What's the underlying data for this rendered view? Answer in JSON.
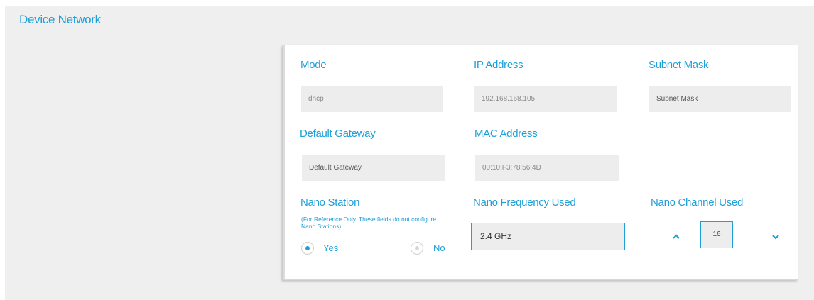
{
  "section": {
    "title": "Device Network"
  },
  "mode": {
    "label": "Mode",
    "value": "dhcp"
  },
  "ip_address": {
    "label": "IP Address",
    "value": "192.168.168.105"
  },
  "subnet_mask": {
    "label": "Subnet Mask",
    "placeholder": "Subnet Mask"
  },
  "default_gateway": {
    "label": "Default Gateway",
    "placeholder": "Default Gateway"
  },
  "mac_address": {
    "label": "MAC Address",
    "value": "00:10:F3:78:56:4D"
  },
  "nano_station": {
    "label": "Nano Station",
    "note": "(For Reference Only. These fields do not configure Nano Stations)",
    "options": [
      {
        "label": "Yes",
        "selected": true
      },
      {
        "label": "No",
        "selected": false
      }
    ]
  },
  "nano_frequency": {
    "label": "Nano Frequency Used",
    "value": "2.4 GHz"
  },
  "nano_channel": {
    "label": "Nano Channel Used",
    "value": "16"
  },
  "colors": {
    "accent": "#1e9fd8",
    "field_bg": "#ededed",
    "panel_bg": "#efefef"
  }
}
